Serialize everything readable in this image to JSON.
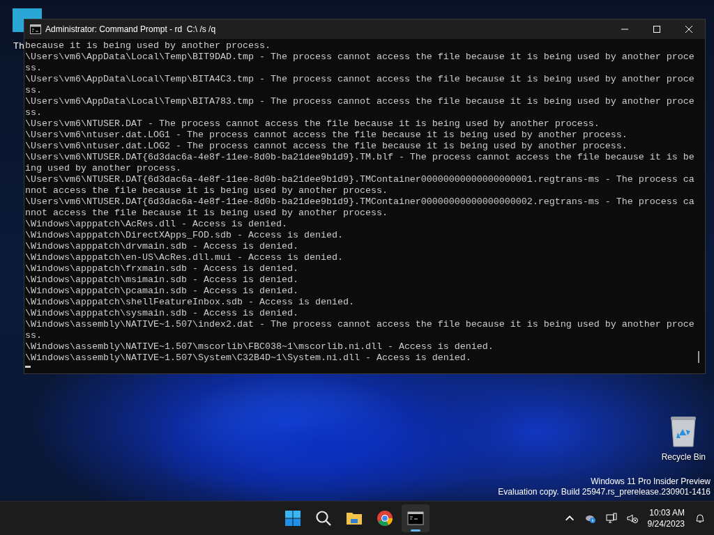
{
  "desktop_icons": [
    {
      "kind": "generic",
      "label": "Th"
    },
    {
      "kind": "recycle",
      "label": "Recycle Bin"
    }
  ],
  "window": {
    "title": "Administrator: Command Prompt - rd  C:\\ /s /q"
  },
  "console": {
    "lines": [
      "because it is being used by another process.",
      "\\Users\\vm6\\AppData\\Local\\Temp\\BIT9DAD.tmp - The process cannot access the file because it is being used by another proce",
      "ss.",
      "\\Users\\vm6\\AppData\\Local\\Temp\\BITA4C3.tmp - The process cannot access the file because it is being used by another proce",
      "ss.",
      "\\Users\\vm6\\AppData\\Local\\Temp\\BITA783.tmp - The process cannot access the file because it is being used by another proce",
      "ss.",
      "\\Users\\vm6\\NTUSER.DAT - The process cannot access the file because it is being used by another process.",
      "\\Users\\vm6\\ntuser.dat.LOG1 - The process cannot access the file because it is being used by another process.",
      "\\Users\\vm6\\ntuser.dat.LOG2 - The process cannot access the file because it is being used by another process.",
      "\\Users\\vm6\\NTUSER.DAT{6d3dac6a-4e8f-11ee-8d0b-ba21dee9b1d9}.TM.blf - The process cannot access the file because it is be",
      "ing used by another process.",
      "\\Users\\vm6\\NTUSER.DAT{6d3dac6a-4e8f-11ee-8d0b-ba21dee9b1d9}.TMContainer00000000000000000001.regtrans-ms - The process ca",
      "nnot access the file because it is being used by another process.",
      "\\Users\\vm6\\NTUSER.DAT{6d3dac6a-4e8f-11ee-8d0b-ba21dee9b1d9}.TMContainer00000000000000000002.regtrans-ms - The process ca",
      "nnot access the file because it is being used by another process.",
      "\\Windows\\apppatch\\AcRes.dll - Access is denied.",
      "\\Windows\\apppatch\\DirectXApps_FOD.sdb - Access is denied.",
      "\\Windows\\apppatch\\drvmain.sdb - Access is denied.",
      "\\Windows\\apppatch\\en-US\\AcRes.dll.mui - Access is denied.",
      "\\Windows\\apppatch\\frxmain.sdb - Access is denied.",
      "\\Windows\\apppatch\\msimain.sdb - Access is denied.",
      "\\Windows\\apppatch\\pcamain.sdb - Access is denied.",
      "\\Windows\\apppatch\\shellFeatureInbox.sdb - Access is denied.",
      "\\Windows\\apppatch\\sysmain.sdb - Access is denied.",
      "\\Windows\\assembly\\NATIVE~1.507\\index2.dat - The process cannot access the file because it is being used by another proce",
      "ss.",
      "\\Windows\\assembly\\NATIVE~1.507\\mscorlib\\FBC038~1\\mscorlib.ni.dll - Access is denied.",
      "\\Windows\\assembly\\NATIVE~1.507\\System\\C32B4D~1\\System.ni.dll - Access is denied."
    ]
  },
  "watermark": {
    "line_1": "Windows 11 Pro Insider Preview",
    "line_2": "Evaluation copy. Build 25947.rs_prerelease.230901-1416"
  },
  "taskbar": {
    "apps": [
      {
        "kind": "start",
        "selected": false
      },
      {
        "kind": "search",
        "selected": false
      },
      {
        "kind": "folder",
        "selected": false
      },
      {
        "kind": "browser",
        "selected": false
      },
      {
        "kind": "terminal",
        "selected": true
      }
    ],
    "time": "10:03 AM",
    "date": "9/24/2023"
  }
}
